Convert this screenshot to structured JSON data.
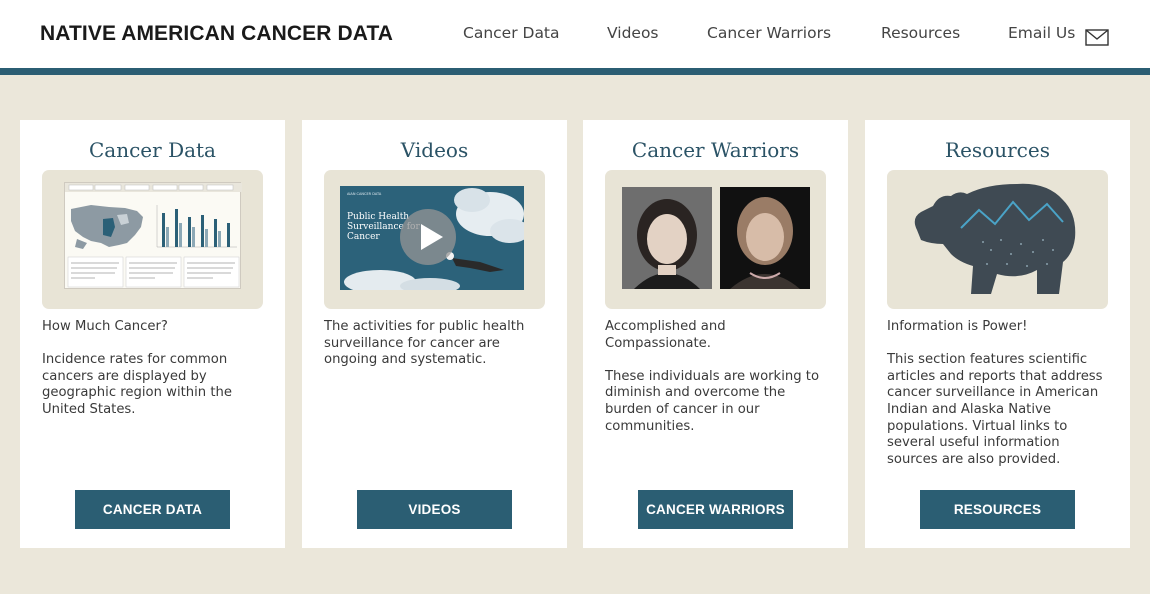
{
  "header": {
    "logo": "NATIVE AMERICAN CANCER DATA",
    "nav": [
      {
        "label": "Cancer Data"
      },
      {
        "label": "Videos"
      },
      {
        "label": "Cancer Warriors"
      },
      {
        "label": "Resources"
      },
      {
        "label": "Email Us"
      }
    ],
    "email_icon": "envelope-icon"
  },
  "cards": [
    {
      "title": "Cancer Data",
      "text": "How Much Cancer?\n\nIncidence rates for common cancers are displayed by geographic region within the United States.",
      "button": "CANCER DATA",
      "thumbnail": "us-map-bar-chart-thumbnail"
    },
    {
      "title": "Videos",
      "text": "The activities for public health surveillance for cancer are ongoing and systematic.",
      "button": "VIDEOS",
      "thumbnail": "video-thumbnail",
      "video": {
        "small_label": "AIAN CANCER DATA",
        "title": "Public Health Surveillance for Cancer"
      }
    },
    {
      "title": "Cancer Warriors",
      "text": "Accomplished and Compassionate.\n\nThese individuals are working to diminish and overcome the burden of cancer in our communities.",
      "button": "CANCER WARRIORS",
      "thumbnail": "portrait-photos"
    },
    {
      "title": "Resources",
      "text": "Information is Power!\n\nThis section features scientific articles and reports that address cancer surveillance in American Indian and Alaska Native populations. Virtual links to several useful information sources are also provided.",
      "button": "RESOURCES",
      "thumbnail": "bear-icon"
    }
  ],
  "colors": {
    "accent": "#2b5e73",
    "title": "#2b5366",
    "background": "#ebe7da",
    "thumb_bg": "#e8e4d6"
  }
}
